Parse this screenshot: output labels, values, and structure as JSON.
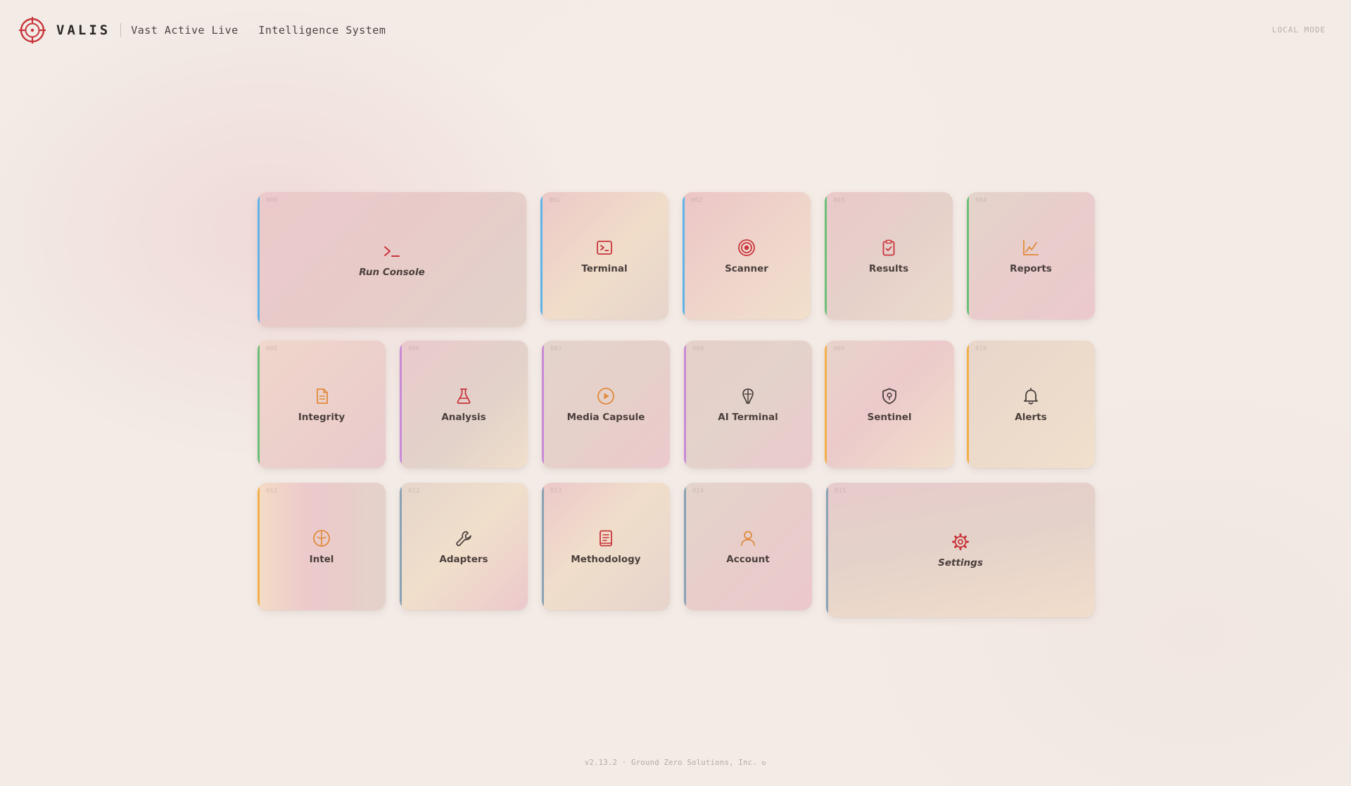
{
  "header": {
    "brand": "VALIS",
    "tagline": "Vast Active Live   Intelligence System",
    "mode": "LOCAL MODE",
    "logo_icon": "crosshair-icon"
  },
  "colors": {
    "brand_red": "#c8343a",
    "icon_orange": "#e08a3a",
    "accent_blue": "#5fb4e8",
    "accent_green": "#6cbf78",
    "accent_purple": "#c98ad8",
    "accent_yellow": "#f2b04a",
    "accent_slate": "#8aa2b4"
  },
  "tiles": [
    {
      "label": "Run Console",
      "code": "000",
      "icon": "terminal-prompt-icon"
    },
    {
      "label": "Terminal",
      "code": "001",
      "icon": "terminal-window-icon"
    },
    {
      "label": "Scanner",
      "code": "002",
      "icon": "target-icon"
    },
    {
      "label": "Results",
      "code": "003",
      "icon": "clipboard-check-icon"
    },
    {
      "label": "Reports",
      "code": "004",
      "icon": "line-chart-icon"
    },
    {
      "label": "Integrity",
      "code": "005",
      "icon": "document-icon"
    },
    {
      "label": "Analysis",
      "code": "006",
      "icon": "flask-icon"
    },
    {
      "label": "Media Capsule",
      "code": "007",
      "icon": "play-circle-icon"
    },
    {
      "label": "AI Terminal",
      "code": "008",
      "icon": "ai-brain-icon"
    },
    {
      "label": "Sentinel",
      "code": "009",
      "icon": "shield-icon"
    },
    {
      "label": "Alerts",
      "code": "010",
      "icon": "bell-icon"
    },
    {
      "label": "Intel",
      "code": "011",
      "icon": "intel-compass-icon"
    },
    {
      "label": "Adapters",
      "code": "012",
      "icon": "wrench-icon"
    },
    {
      "label": "Methodology",
      "code": "013",
      "icon": "book-icon"
    },
    {
      "label": "Account",
      "code": "014",
      "icon": "user-icon"
    },
    {
      "label": "Settings",
      "code": "015",
      "icon": "gear-icon"
    }
  ],
  "footer": {
    "text": "v2.13.2 · Ground Zero Solutions, Inc. ↻"
  }
}
